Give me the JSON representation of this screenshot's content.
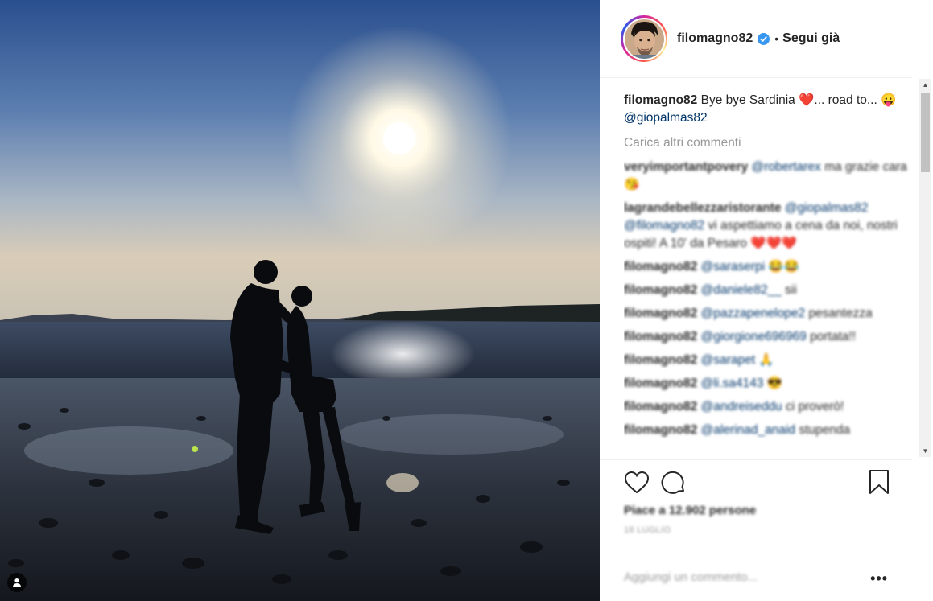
{
  "header": {
    "username": "filomagno82",
    "separator": "•",
    "follow_label": "Segui già"
  },
  "caption": {
    "username": "filomagno82",
    "text": "Bye bye Sardinia ❤️... road to... 😛",
    "mention": "@giopalmas82"
  },
  "load_more_label": "Carica altri commenti",
  "comments": [
    {
      "user": "veryimportantpovery",
      "mention": "@robertarex",
      "text": "ma grazie cara 😘"
    },
    {
      "user": "lagrandebellezzaristorante",
      "mention": "@giopalmas82 @filomagno82",
      "text": "vi aspettiamo a cena da noi, nostri ospiti! A 10' da Pesaro ❤️❤️❤️"
    },
    {
      "user": "filomagno82",
      "mention": "@saraserpi",
      "text": "😂😂"
    },
    {
      "user": "filomagno82",
      "mention": "@daniele82__",
      "text": "sii"
    },
    {
      "user": "filomagno82",
      "mention": "@pazzapenelope2",
      "text": "pesantezza"
    },
    {
      "user": "filomagno82",
      "mention": "@giorgione696969",
      "text": "portata!!"
    },
    {
      "user": "filomagno82",
      "mention": "@sarapet",
      "text": "🙏"
    },
    {
      "user": "filomagno82",
      "mention": "@li.sa4143",
      "text": "😎"
    },
    {
      "user": "filomagno82",
      "mention": "@andreiseddu",
      "text": "ci proverò!"
    },
    {
      "user": "filomagno82",
      "mention": "@alerinad_anaid",
      "text": "stupenda"
    }
  ],
  "likes_text": "Piace a 12.902 persone",
  "date_text": "18 LUGLIO",
  "add_comment_placeholder": "Aggiungi un commento...",
  "more_options": "•••",
  "icons": {
    "like": "heart-icon",
    "comment": "comment-icon",
    "save": "bookmark-icon",
    "tag": "user-tag-icon",
    "verified": "verified-badge-icon"
  },
  "colors": {
    "mention": "#003569",
    "verified": "#3897f0",
    "muted": "#999999"
  }
}
